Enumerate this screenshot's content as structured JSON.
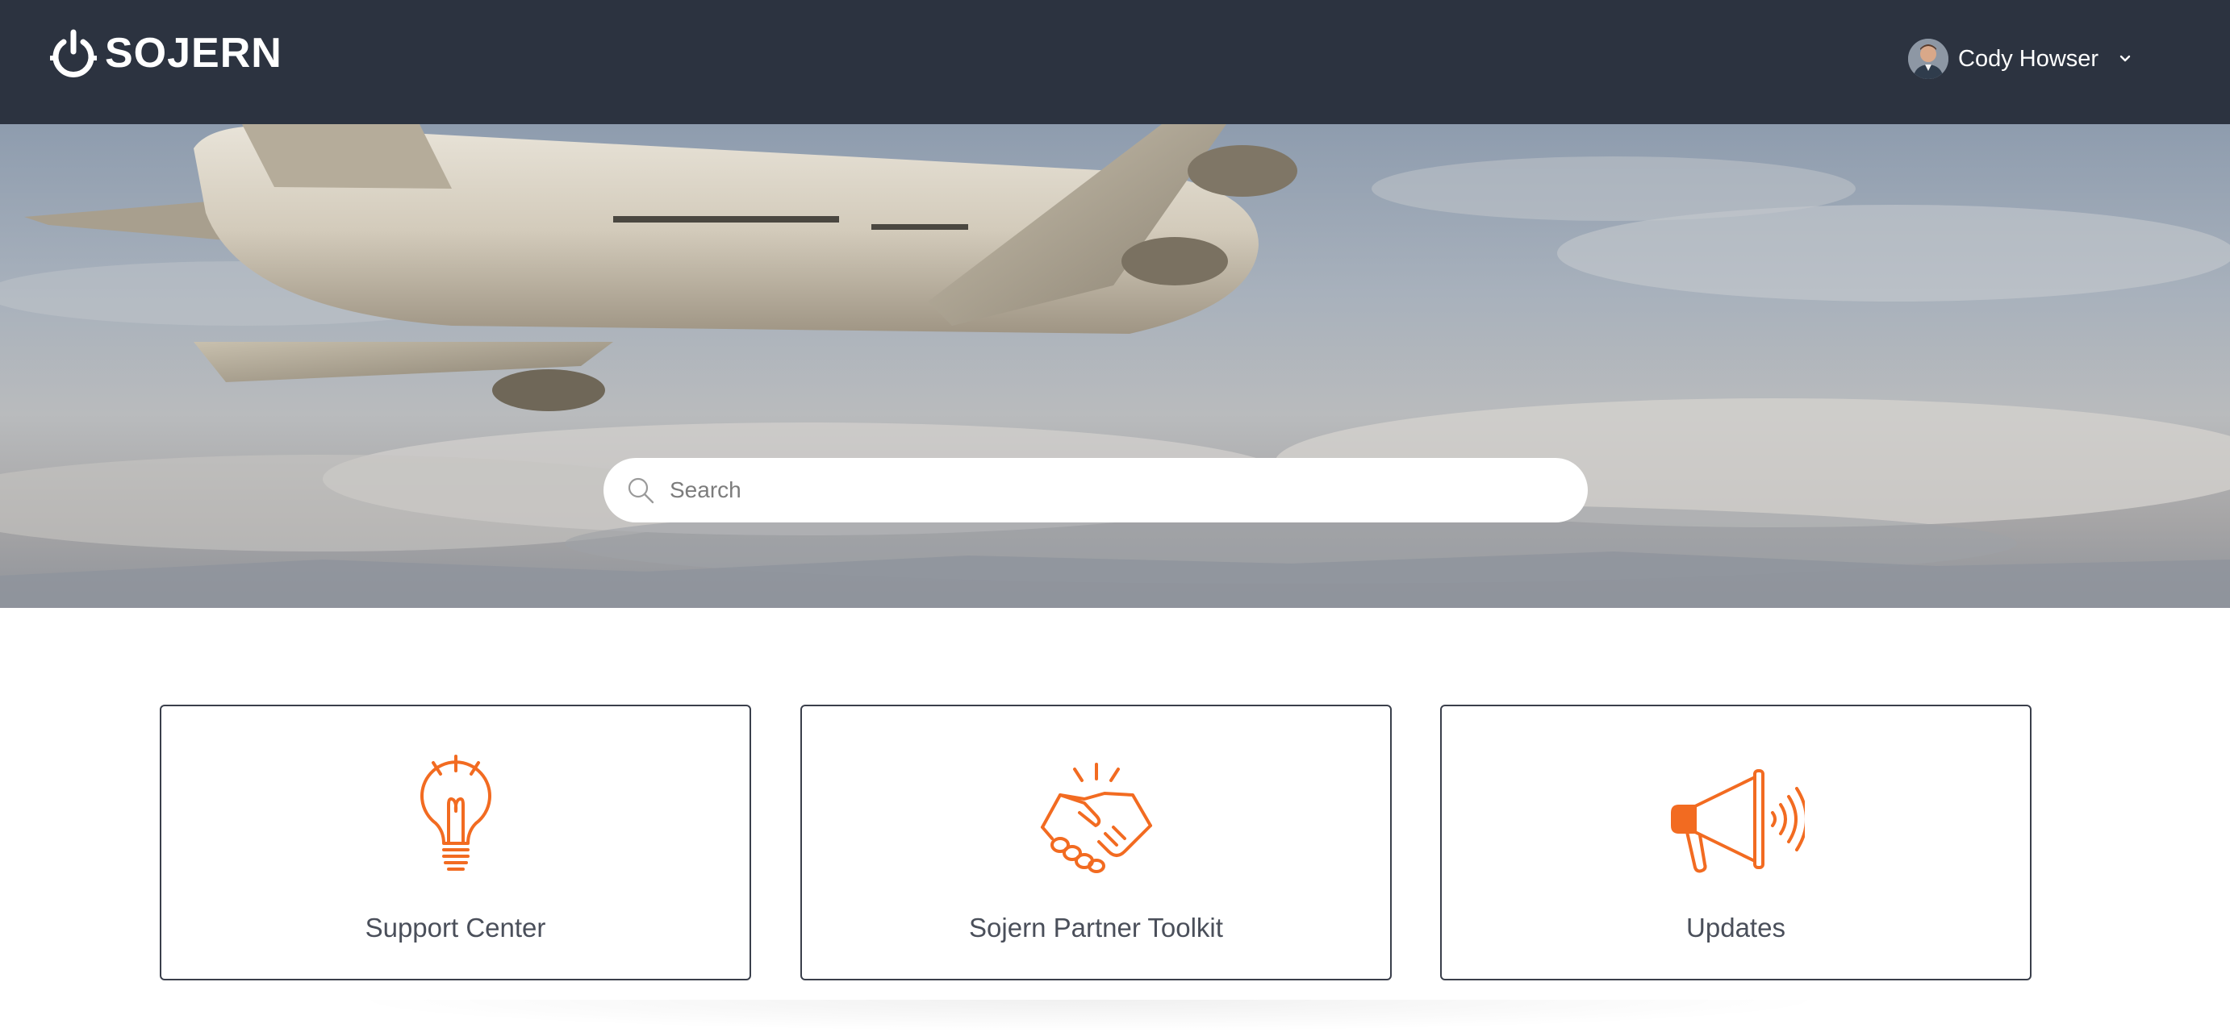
{
  "header": {
    "logo_text": "SOJERN",
    "user": {
      "name": "Cody Howser"
    }
  },
  "search": {
    "placeholder": "Search"
  },
  "cards": [
    {
      "label": "Support Center",
      "icon": "lightbulb-icon"
    },
    {
      "label": "Sojern Partner Toolkit",
      "icon": "handshake-icon"
    },
    {
      "label": "Updates",
      "icon": "megaphone-icon"
    }
  ],
  "colors": {
    "header_bg": "#2c3340",
    "accent": "#f26b21",
    "card_border": "#3a3f4b",
    "card_text": "#4a4f5a"
  }
}
